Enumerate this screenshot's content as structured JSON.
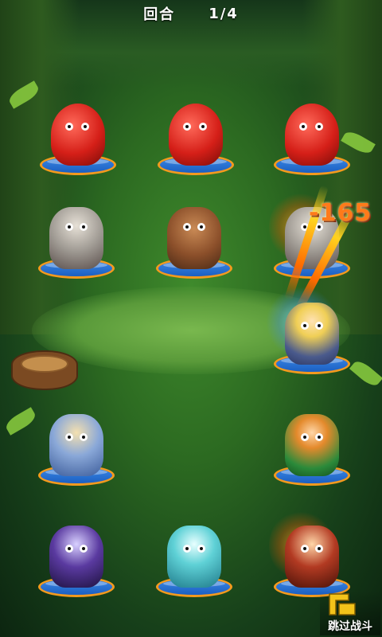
{
  "header": {
    "round_label": "回合",
    "round_progress": "1/4"
  },
  "damage_popup": "-165",
  "skip_button": {
    "label": "跳过战斗"
  },
  "enemies": [
    {
      "slot": "top-left",
      "type": "red-blob-monster"
    },
    {
      "slot": "top-center",
      "type": "red-blob-monster"
    },
    {
      "slot": "top-right",
      "type": "red-blob-monster"
    },
    {
      "slot": "second-left",
      "type": "skeleton-knight"
    },
    {
      "slot": "second-center",
      "type": "minotaur"
    },
    {
      "slot": "second-right",
      "type": "skeleton-knight"
    }
  ],
  "heroes": [
    {
      "slot": "third-right",
      "type": "armored-knight"
    },
    {
      "slot": "fourth-left",
      "type": "sword-maiden"
    },
    {
      "slot": "fourth-right",
      "type": "green-archer"
    },
    {
      "slot": "bottom-left",
      "type": "shadow-ninja"
    },
    {
      "slot": "bottom-center",
      "type": "ice-fox-spirit"
    },
    {
      "slot": "bottom-right",
      "type": "fire-fighter"
    }
  ],
  "colors": {
    "pad_blue": "#1b5fc2",
    "pad_rim": "#f39a1e",
    "damage_text": "#ff7a1a"
  }
}
